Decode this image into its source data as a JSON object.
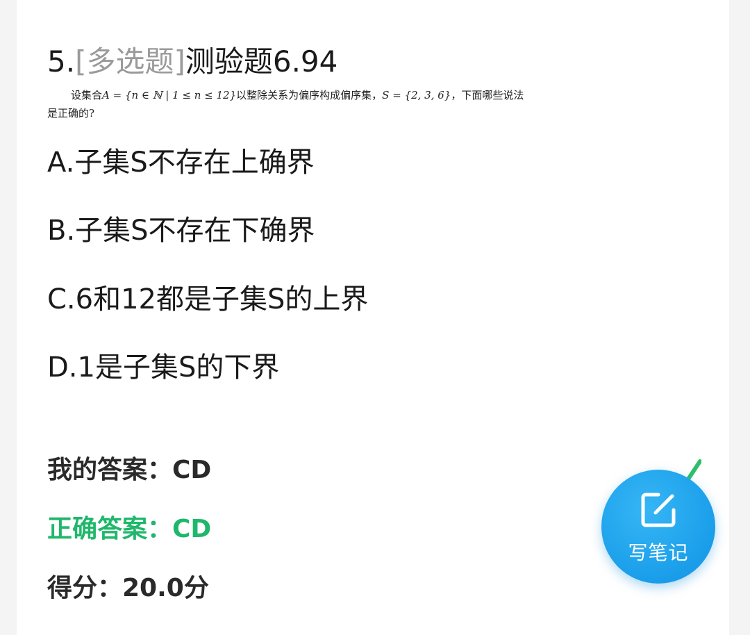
{
  "question": {
    "number": "5.",
    "type": "[多选题]",
    "title": "测验题6.94",
    "stem_line1_prefix": "设集合",
    "stem_set_A": "A = {n ∈ ℕ | 1 ≤ n ≤ 12}",
    "stem_line1_mid": "以整除关系为偏序构成偏序集，",
    "stem_set_S": "S = {2, 3, 6}",
    "stem_line1_suffix": "，下面哪些说法",
    "stem_line2": "是正确的?"
  },
  "options": [
    {
      "label": "A.子集S不存在上确界"
    },
    {
      "label": "B.子集S不存在下确界"
    },
    {
      "label": "C.6和12都是子集S的上界"
    },
    {
      "label": "D.1是子集S的下界"
    }
  ],
  "result": {
    "my_answer": "我的答案：CD",
    "correct_answer": "正确答案：CD",
    "score": "得分：20.0分"
  },
  "note_button": {
    "label": "写笔记",
    "icon": "edit-note-icon"
  },
  "colors": {
    "correct": "#1fb76b",
    "accent": "#1a9eea",
    "question_type": "#9a9a9a"
  }
}
